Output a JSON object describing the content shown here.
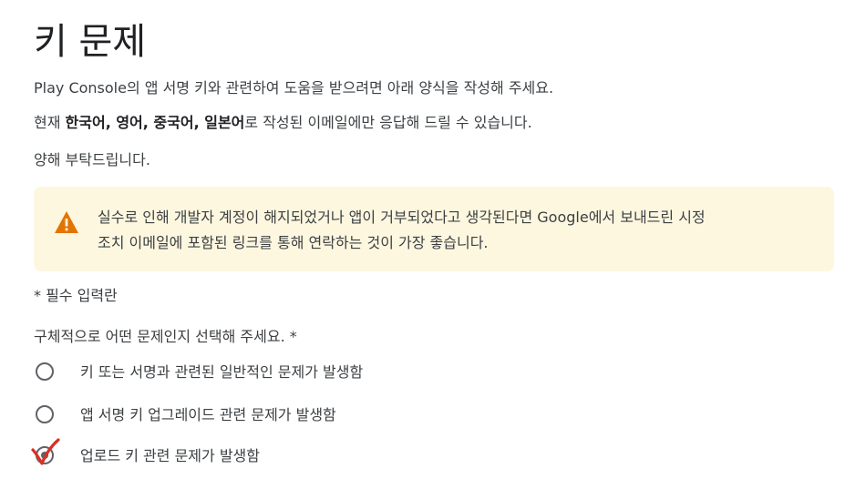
{
  "title": "키 문제",
  "intro": {
    "line1": "Play Console의 앱 서명 키와 관련하여 도움을 받으려면 아래 양식을 작성해 주세요.",
    "line2_prefix": "현재 ",
    "line2_langs": "한국어, 영어, 중국어, 일본어",
    "line2_suffix": "로 작성된 이메일에만 응답해 드릴 수 있습니다.",
    "line3": "양해 부탁드립니다."
  },
  "warning": {
    "icon": "warning-triangle-icon",
    "line1": "실수로 인해 개발자 계정이 해지되었거나 앱이 거부되었다고 생각된다면 Google에서 보내드린 시정",
    "line2": "조치 이메일에 포함된 링크를 통해 연락하는 것이 가장 좋습니다."
  },
  "required_note": "* 필수 입력란",
  "question": "구체적으로 어떤 문제인지 선택해 주세요. *",
  "options": [
    {
      "label": "키 또는 서명과 관련된 일반적인 문제가 발생함",
      "selected": false
    },
    {
      "label": "앱 서명 키 업그레이드 관련 문제가 발생함",
      "selected": false
    },
    {
      "label": "업로드 키 관련 문제가 발생함",
      "selected": true
    }
  ],
  "colors": {
    "warning_bg": "#fef7e0",
    "warning_icon": "#e37400",
    "check_mark": "#d93025"
  }
}
